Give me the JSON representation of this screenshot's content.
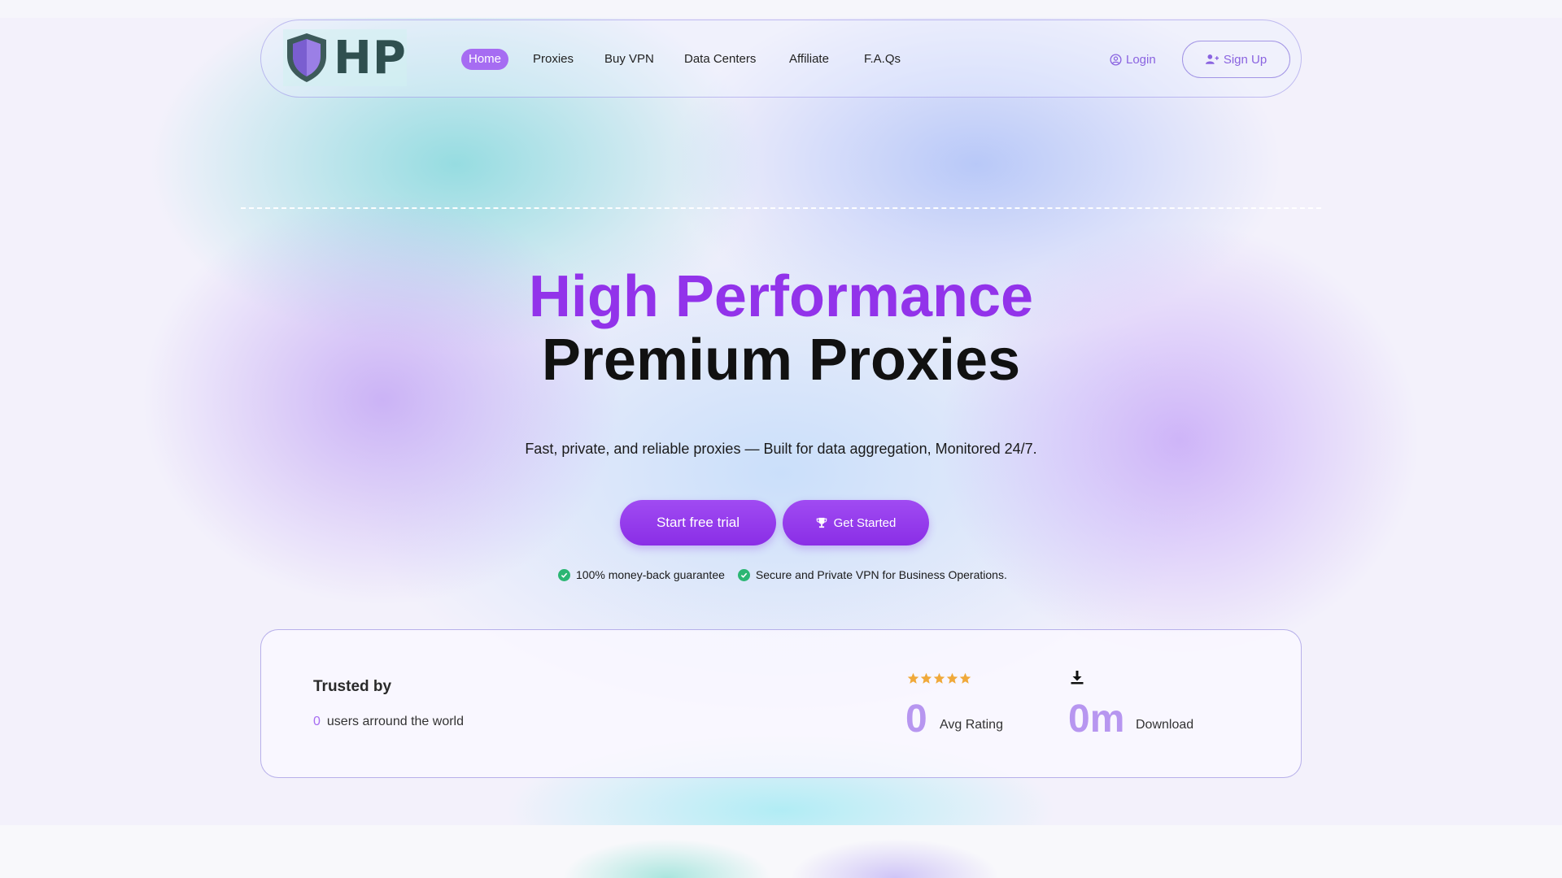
{
  "brand": {
    "logo_text": "HP",
    "accent": "#9233ea",
    "accent_light": "#a66cf2"
  },
  "nav": {
    "items": [
      {
        "label": "Home",
        "active": true
      },
      {
        "label": "Proxies",
        "active": false
      },
      {
        "label": "Buy VPN",
        "active": false
      },
      {
        "label": "Data Centers",
        "active": false
      },
      {
        "label": "Affiliate",
        "active": false
      },
      {
        "label": "F.A.Qs",
        "active": false
      }
    ],
    "login_label": "Login",
    "signup_label": "Sign Up"
  },
  "hero": {
    "title_line1": "High Performance",
    "title_line2": "Premium Proxies",
    "subtitle": "Fast, private, and reliable proxies — Built for data aggregation, Monitored 24/7.",
    "primary_cta": "Start free trial",
    "secondary_cta": "Get Started",
    "checks": [
      "100% money-back guarantee",
      "Secure and Private VPN for Business Operations."
    ]
  },
  "stats": {
    "trusted_title": "Trusted by",
    "users_count": "0",
    "users_label": "users arround the world",
    "rating_stars": 5,
    "rating_value": "0",
    "rating_label": "Avg Rating",
    "downloads_value": "0m",
    "downloads_label": "Download"
  }
}
